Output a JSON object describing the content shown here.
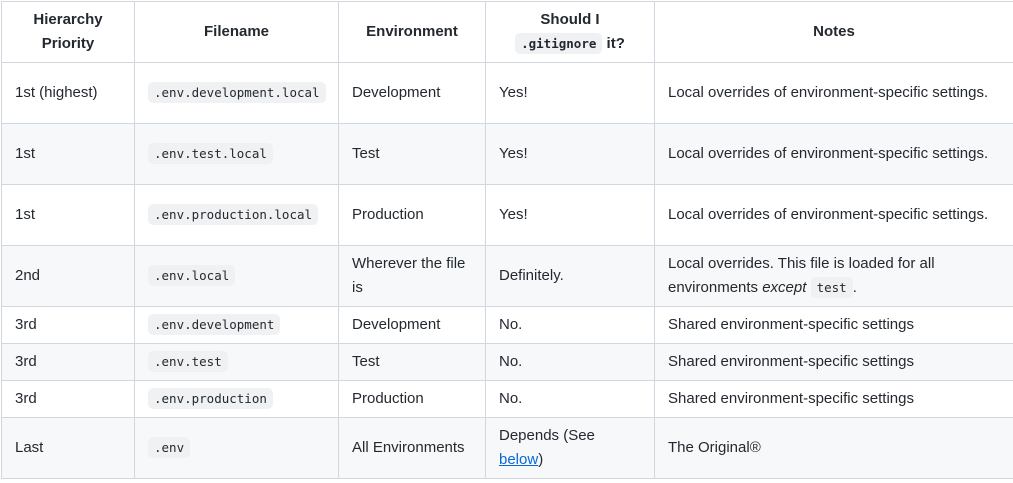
{
  "headers": {
    "priority_line1": "Hierarchy",
    "priority_line2": "Priority",
    "filename": "Filename",
    "environment": "Environment",
    "gitignore_line1": "Should I",
    "gitignore_code": ".gitignore",
    "gitignore_suffix": " it?",
    "notes": "Notes"
  },
  "rows": [
    {
      "priority": "1st (highest)",
      "filename": ".env.development.local",
      "environment": "Development",
      "gitignore": "Yes!",
      "notes": "Local overrides of environment-specific settings."
    },
    {
      "priority": "1st",
      "filename": ".env.test.local",
      "environment": "Test",
      "gitignore": "Yes!",
      "notes": "Local overrides of environment-specific settings."
    },
    {
      "priority": "1st",
      "filename": ".env.production.local",
      "environment": "Production",
      "gitignore": "Yes!",
      "notes": "Local overrides of environment-specific settings."
    },
    {
      "priority": "2nd",
      "filename": ".env.local",
      "environment": "Wherever the file is",
      "gitignore": "Definitely.",
      "notes_prefix": "Local overrides. This file is loaded for all environments ",
      "notes_em": "except",
      "notes_code": "test",
      "notes_suffix": "."
    },
    {
      "priority": "3rd",
      "filename": ".env.development",
      "environment": "Development",
      "gitignore": "No.",
      "notes": "Shared environment-specific settings"
    },
    {
      "priority": "3rd",
      "filename": ".env.test",
      "environment": "Test",
      "gitignore": "No.",
      "notes": "Shared environment-specific settings"
    },
    {
      "priority": "3rd",
      "filename": ".env.production",
      "environment": "Production",
      "gitignore": "No.",
      "notes": "Shared environment-specific settings"
    },
    {
      "priority": "Last",
      "filename": ".env",
      "environment": "All Environments",
      "gitignore_prefix": "Depends (See ",
      "gitignore_link": "below",
      "gitignore_suffix": ")",
      "notes": "The Original®"
    }
  ],
  "colors": {
    "border": "#d0d7de",
    "stripe": "#f6f8fa",
    "code_bg": "#eff1f3",
    "link": "#0969da",
    "text": "#24292f"
  }
}
